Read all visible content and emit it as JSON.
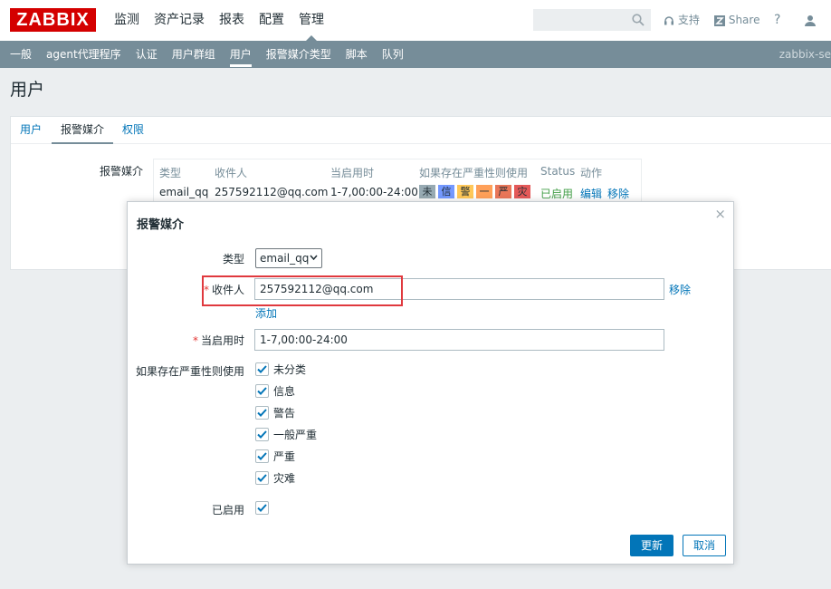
{
  "header": {
    "logo": "ZABBIX",
    "menu": [
      "监测",
      "资产记录",
      "报表",
      "配置",
      "管理"
    ],
    "search_placeholder": "",
    "support_label": "支持",
    "share_label": "Share",
    "help_label": "?"
  },
  "subnav": {
    "items": [
      "一般",
      "agent代理程序",
      "认证",
      "用户群组",
      "用户",
      "报警媒介类型",
      "脚本",
      "队列"
    ],
    "active_index": 4,
    "server_name": "zabbix-se"
  },
  "page": {
    "title": "用户"
  },
  "tabs": [
    "用户",
    "报警媒介",
    "权限"
  ],
  "media": {
    "label": "报警媒介",
    "headers": [
      "类型",
      "收件人",
      "当启用时",
      "如果存在严重性则使用",
      "Status",
      "动作"
    ],
    "row": {
      "type": "email_qq",
      "recipient": "257592112@qq.com",
      "when_active": "1-7,00:00-24:00",
      "severities": [
        "未",
        "信",
        "警",
        "一",
        "严",
        "灾"
      ],
      "severity_colors": [
        "#97aab3",
        "#7499ff",
        "#ffc859",
        "#ffa059",
        "#e97659",
        "#e45959"
      ],
      "status": "已启用",
      "edit": "编辑",
      "remove": "移除"
    }
  },
  "dialog": {
    "title": "报警媒介",
    "close": "×",
    "type_label": "类型",
    "type_value": "email_qq",
    "recipient_label": "收件人",
    "recipient_value": "257592112@qq.com",
    "remove_link": "移除",
    "add_link": "添加",
    "when_label": "当启用时",
    "when_value": "1-7,00:00-24:00",
    "severity_label": "如果存在严重性则使用",
    "severities": [
      "未分类",
      "信息",
      "警告",
      "一般严重",
      "严重",
      "灾难"
    ],
    "enabled_label": "已启用",
    "update_button": "更新",
    "cancel_button": "取消"
  },
  "colors": {
    "brand": "#d40000",
    "nav": "#768d99",
    "accent": "#0275b8",
    "highlight_box": "#e0393e"
  }
}
